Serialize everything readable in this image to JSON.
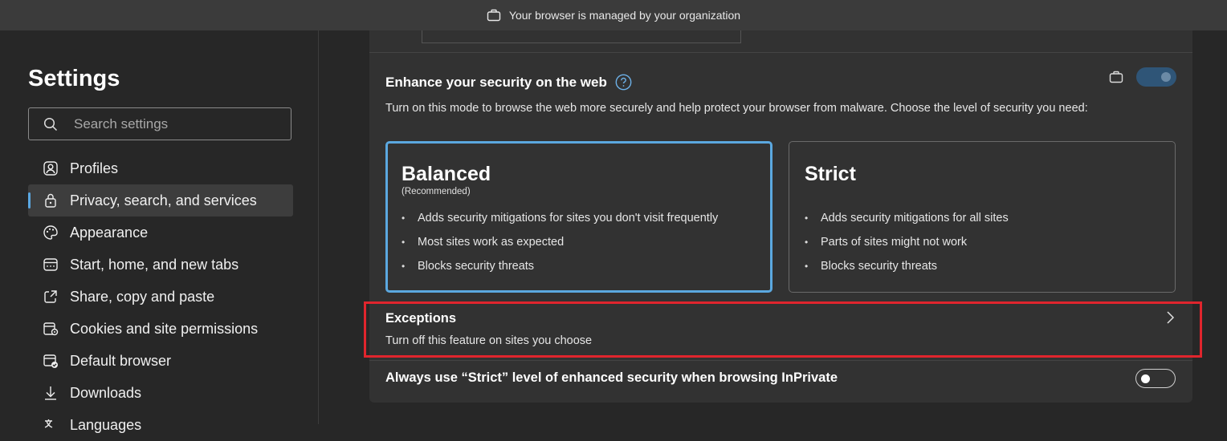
{
  "managed_banner": {
    "text": "Your browser is managed by your organization",
    "icon": "briefcase-icon"
  },
  "sidebar": {
    "title": "Settings",
    "search": {
      "placeholder": "Search settings"
    },
    "items": [
      {
        "label": "Profiles",
        "icon": "profile-icon",
        "active": false
      },
      {
        "label": "Privacy, search, and services",
        "icon": "lock-icon",
        "active": true
      },
      {
        "label": "Appearance",
        "icon": "palette-icon",
        "active": false
      },
      {
        "label": "Start, home, and new tabs",
        "icon": "home-tabs-icon",
        "active": false
      },
      {
        "label": "Share, copy and paste",
        "icon": "share-icon",
        "active": false
      },
      {
        "label": "Cookies and site permissions",
        "icon": "cookies-icon",
        "active": false
      },
      {
        "label": "Default browser",
        "icon": "default-browser-icon",
        "active": false
      },
      {
        "label": "Downloads",
        "icon": "download-icon",
        "active": false
      },
      {
        "label": "Languages",
        "icon": "languages-icon",
        "active": false
      }
    ]
  },
  "security": {
    "title": "Enhance your security on the web",
    "description": "Turn on this mode to browse the web more securely and help protect your browser from malware. Choose the level of security you need:",
    "toggle_on": true,
    "options": {
      "balanced": {
        "name": "Balanced",
        "note": "(Recommended)",
        "bullets": [
          "Adds security mitigations for sites you don't visit frequently",
          "Most sites work as expected",
          "Blocks security threats"
        ],
        "selected": true
      },
      "strict": {
        "name": "Strict",
        "bullets": [
          "Adds security mitigations for all sites",
          "Parts of sites might not work",
          "Blocks security threats"
        ],
        "selected": false
      }
    },
    "exceptions": {
      "title": "Exceptions",
      "subtitle": "Turn off this feature on sites you choose"
    },
    "inprivate": {
      "label": "Always use “Strict” level of enhanced security when browsing InPrivate",
      "toggle_on": false
    }
  },
  "colors": {
    "accent": "#5ba8e0",
    "highlight": "#e0252d",
    "background": "#272727",
    "card": "#323232"
  }
}
